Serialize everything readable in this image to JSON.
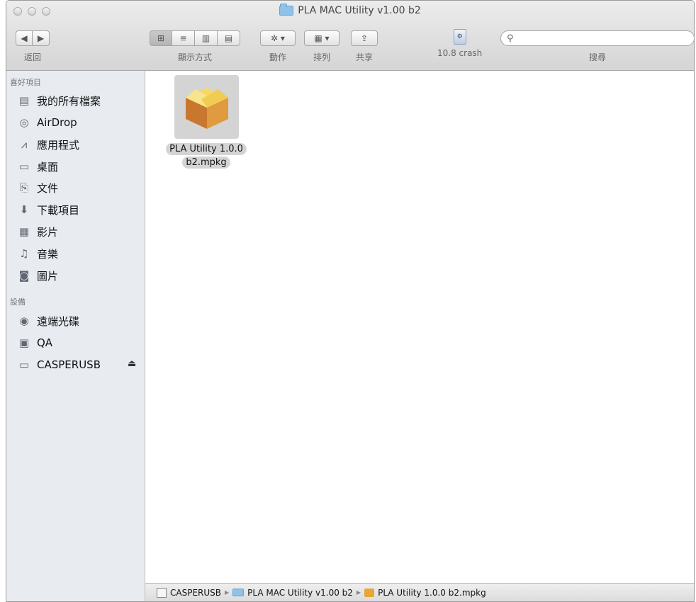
{
  "window": {
    "title": "PLA MAC Utility  v1.00 b2"
  },
  "toolbar": {
    "back_label": "返回",
    "view_label": "顯示方式",
    "action_label": "動作",
    "arrange_label": "排列",
    "share_label": "共享",
    "crash_label": "10.8 crash",
    "search_label": "搜尋",
    "search_value": ""
  },
  "sidebar": {
    "favorites_header": "喜好項目",
    "favorites": [
      {
        "label": "我的所有檔案",
        "icon": "all-files-icon"
      },
      {
        "label": "AirDrop",
        "icon": "airdrop-icon"
      },
      {
        "label": "應用程式",
        "icon": "applications-icon"
      },
      {
        "label": "桌面",
        "icon": "desktop-icon"
      },
      {
        "label": "文件",
        "icon": "documents-icon"
      },
      {
        "label": "下載項目",
        "icon": "downloads-icon"
      },
      {
        "label": "影片",
        "icon": "movies-icon"
      },
      {
        "label": "音樂",
        "icon": "music-icon"
      },
      {
        "label": "圖片",
        "icon": "pictures-icon"
      }
    ],
    "devices_header": "設備",
    "devices": [
      {
        "label": "遠端光碟",
        "icon": "remote-disc-icon"
      },
      {
        "label": "QA",
        "icon": "hard-drive-icon"
      },
      {
        "label": "CASPERUSB",
        "icon": "usb-drive-icon"
      }
    ]
  },
  "main": {
    "file": {
      "name_line1": "PLA Utility 1.0.0",
      "name_line2": "b2.mpkg",
      "icon": "package-icon"
    }
  },
  "pathbar": {
    "items": [
      "CASPERUSB",
      "PLA MAC Utility  v1.00 b2",
      "PLA Utility 1.0.0 b2.mpkg"
    ]
  },
  "colors": {
    "sidebar_bg": "#e8ecf1",
    "selection": "#d4d4d4",
    "folder": "#8fc2e8"
  }
}
